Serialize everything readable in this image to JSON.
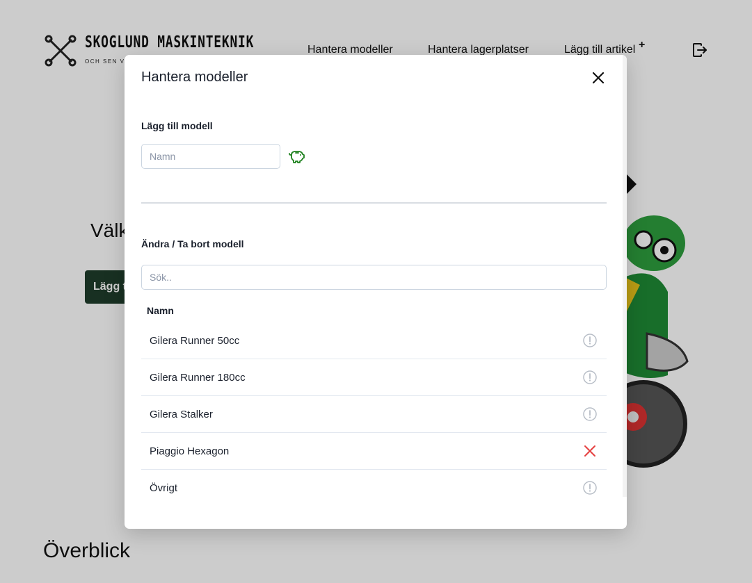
{
  "header": {
    "logo": {
      "title": "SKOGLUND MASKINTEKNIK",
      "subtitle": "OCH SEN VA"
    },
    "nav": [
      {
        "label": "Hantera modeller"
      },
      {
        "label": "Hantera lagerplatser"
      },
      {
        "label": "Lägg till artikel"
      }
    ],
    "nav_plus": "+",
    "logout_icon": "logout-icon"
  },
  "background": {
    "welcome": "Välk",
    "add_button": "Lägg t",
    "overview_heading": "Överblick",
    "button_color": "#1f3d2b"
  },
  "modal": {
    "title": "Hantera modeller",
    "close_icon": "close-icon",
    "add_section": {
      "label": "Lägg till modell",
      "input_value": "",
      "input_placeholder": "Namn",
      "save_icon": "piggy-bank-icon",
      "save_icon_color": "#1a7f1a"
    },
    "edit_section": {
      "label": "Ändra / Ta bort modell",
      "search_value": "",
      "search_placeholder": "Sök..",
      "column_header": "Namn",
      "models": [
        {
          "name": "Gilera Runner 50cc",
          "action_icon": "info-circle-icon"
        },
        {
          "name": "Gilera Runner 180cc",
          "action_icon": "info-circle-icon"
        },
        {
          "name": "Gilera Stalker",
          "action_icon": "info-circle-icon"
        },
        {
          "name": "Piaggio Hexagon",
          "action_icon": "delete-x-icon"
        },
        {
          "name": "Övrigt",
          "action_icon": "info-circle-icon"
        }
      ]
    },
    "colors": {
      "delete": "#e53e3e",
      "info": "#b8bec7"
    }
  }
}
